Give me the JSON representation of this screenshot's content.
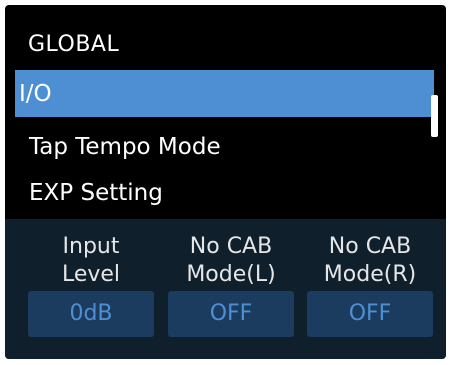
{
  "header": {
    "title": "GLOBAL"
  },
  "menu": {
    "items": [
      {
        "label": "I/O",
        "selected": true
      },
      {
        "label": "Tap Tempo Mode",
        "selected": false
      },
      {
        "label": "EXP Setting",
        "selected": false
      }
    ]
  },
  "params": [
    {
      "label_line1": "Input",
      "label_line2": "Level",
      "value": "0dB"
    },
    {
      "label_line1": "No CAB",
      "label_line2": "Mode(L)",
      "value": "OFF"
    },
    {
      "label_line1": "No CAB",
      "label_line2": "Mode(R)",
      "value": "OFF"
    }
  ],
  "colors": {
    "selection": "#4d8fd2",
    "param_panel": "#0f1f2c",
    "value_box": "#1b3c5e",
    "value_text": "#4e8fd4"
  }
}
